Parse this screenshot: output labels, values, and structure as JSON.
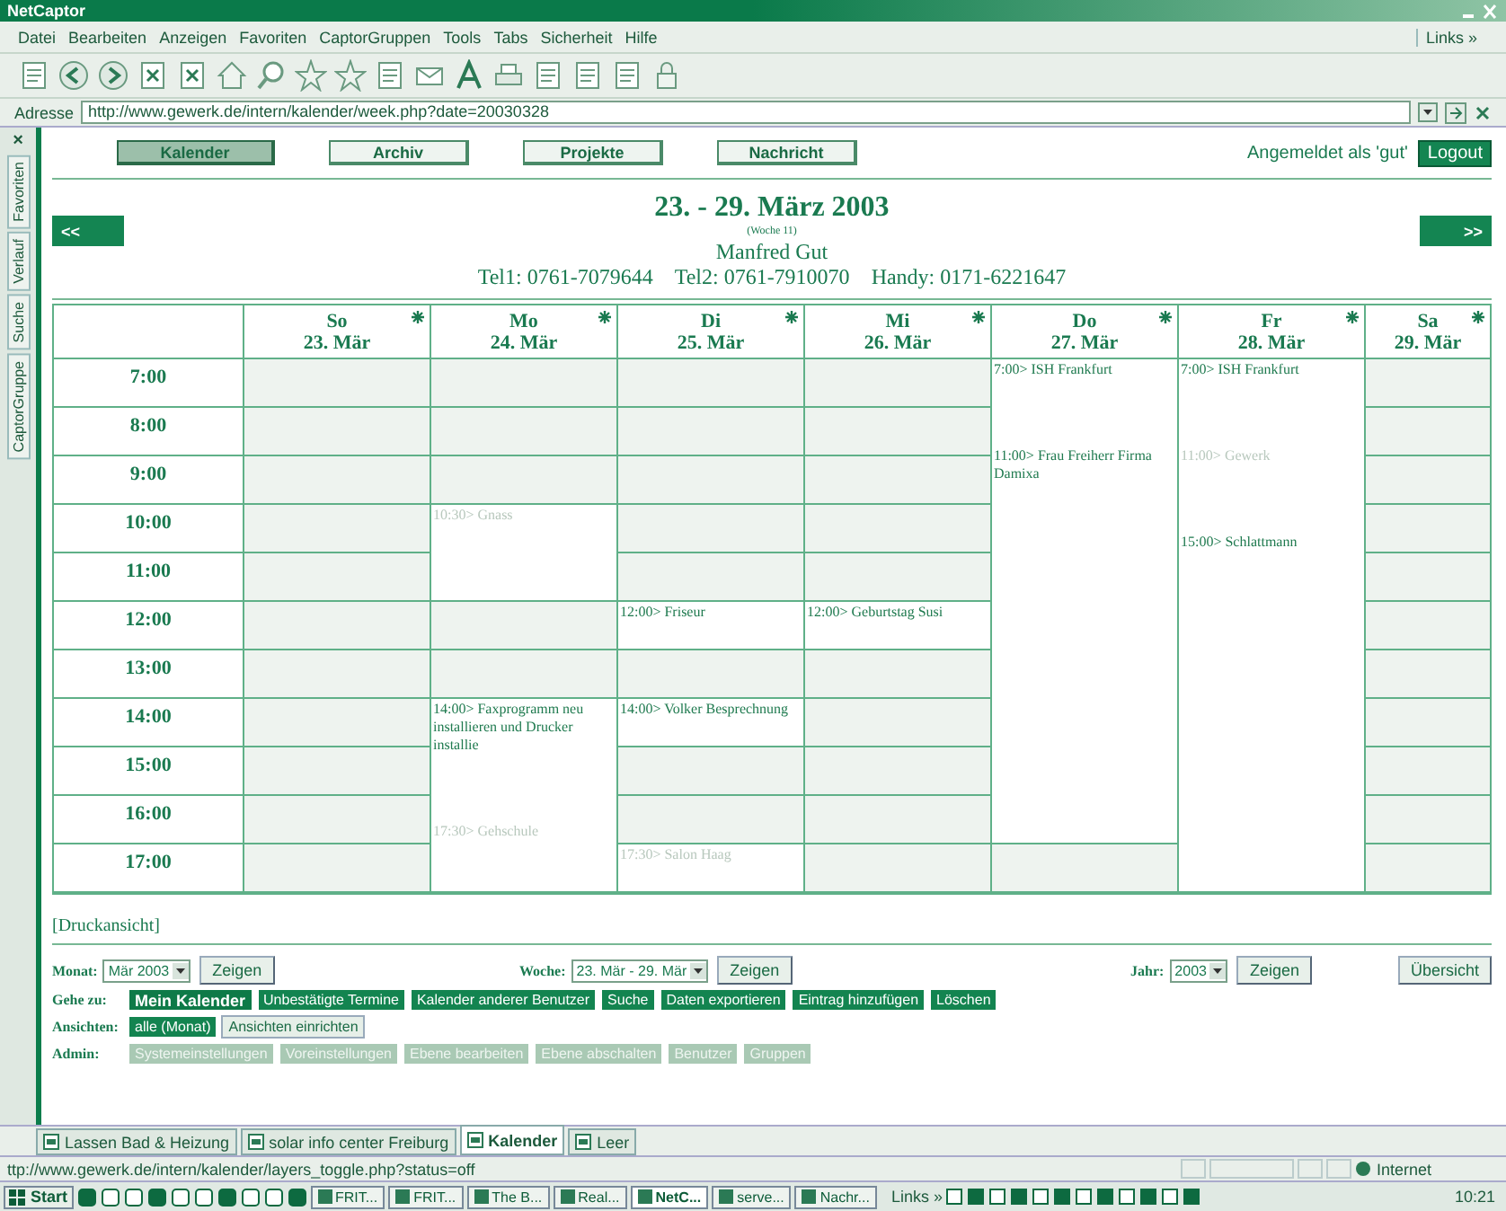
{
  "window": {
    "title": "NetCaptor"
  },
  "menu": [
    "Datei",
    "Bearbeiten",
    "Anzeigen",
    "Favoriten",
    "CaptorGruppen",
    "Tools",
    "Tabs",
    "Sicherheit",
    "Hilfe"
  ],
  "links": {
    "label": "Links",
    "more": "»"
  },
  "address": {
    "label": "Adresse",
    "value": "http://www.gewerk.de/intern/kalender/week.php?date=20030328"
  },
  "side_panel": {
    "close": "×",
    "tabs": [
      "Favoriten",
      "Verlauf",
      "Suche",
      "CaptorGruppe"
    ]
  },
  "nav": [
    {
      "label": "Kalender",
      "selected": true
    },
    {
      "label": "Archiv",
      "selected": false
    },
    {
      "label": "Projekte",
      "selected": false
    },
    {
      "label": "Nachricht",
      "selected": false
    }
  ],
  "login": "Angemeldet als 'gut'",
  "logout": "Logout",
  "prev": "<<",
  "next": ">>",
  "heading": {
    "title": "23. - 29. März 2003",
    "week": "(Woche 11)",
    "name": "Manfred Gut",
    "phones": [
      "Tel1: 0761-7079644",
      "Tel2: 0761-7910070",
      "Handy: 0171-6221647"
    ]
  },
  "hours": [
    "7:00",
    "8:00",
    "9:00",
    "10:00",
    "11:00",
    "12:00",
    "13:00",
    "14:00",
    "15:00",
    "16:00",
    "17:00"
  ],
  "days": [
    {
      "name": "So",
      "date": "23. Mär",
      "slots": [
        {
          "kind": "free"
        },
        {
          "kind": "free"
        },
        {
          "kind": "free"
        },
        {
          "kind": "free"
        },
        {
          "kind": "free"
        },
        {
          "kind": "free"
        },
        {
          "kind": "free"
        },
        {
          "kind": "free"
        },
        {
          "kind": "free"
        },
        {
          "kind": "free"
        },
        {
          "kind": "free"
        }
      ]
    },
    {
      "name": "Mo",
      "date": "24. Mär",
      "slots": [
        {
          "kind": "free"
        },
        {
          "kind": "free"
        },
        {
          "kind": "free"
        },
        {
          "kind": "event",
          "entries": [
            {
              "text": "10:30> Gnass",
              "dimmed": true
            }
          ]
        },
        {
          "kind": "continued"
        },
        {
          "kind": "free"
        },
        {
          "kind": "free"
        },
        {
          "kind": "event",
          "entries": [
            {
              "text": "14:00> Faxprogramm neu installieren und Drucker installie",
              "dimmed": false
            },
            {
              "text": "17:30> Gehschule",
              "dimmed": true
            }
          ]
        },
        {
          "kind": "continued"
        },
        {
          "kind": "continued"
        },
        {
          "kind": "continued"
        }
      ]
    },
    {
      "name": "Di",
      "date": "25. Mär",
      "slots": [
        {
          "kind": "free"
        },
        {
          "kind": "free"
        },
        {
          "kind": "free"
        },
        {
          "kind": "free"
        },
        {
          "kind": "free"
        },
        {
          "kind": "event",
          "entries": [
            {
              "text": "12:00> Friseur",
              "dimmed": false
            }
          ]
        },
        {
          "kind": "free"
        },
        {
          "kind": "event",
          "entries": [
            {
              "text": "14:00> Volker Besprechnung",
              "dimmed": false
            }
          ]
        },
        {
          "kind": "free"
        },
        {
          "kind": "free"
        },
        {
          "kind": "event",
          "entries": [
            {
              "text": "17:30> Salon Haag",
              "dimmed": true
            }
          ]
        }
      ]
    },
    {
      "name": "Mi",
      "date": "26. Mär",
      "slots": [
        {
          "kind": "free"
        },
        {
          "kind": "free"
        },
        {
          "kind": "free"
        },
        {
          "kind": "free"
        },
        {
          "kind": "free"
        },
        {
          "kind": "event",
          "entries": [
            {
              "text": "12:00> Geburtstag Susi",
              "dimmed": false
            }
          ]
        },
        {
          "kind": "free"
        },
        {
          "kind": "free"
        },
        {
          "kind": "free"
        },
        {
          "kind": "free"
        },
        {
          "kind": "free"
        }
      ]
    },
    {
      "name": "Do",
      "date": "27. Mär",
      "slots": [
        {
          "kind": "event",
          "entries": [
            {
              "text": "7:00> ISH Frankfurt",
              "dimmed": false
            },
            {
              "text": "11:00> Frau Freiherr Firma Damixa",
              "dimmed": false
            }
          ]
        },
        {
          "kind": "continued"
        },
        {
          "kind": "continued"
        },
        {
          "kind": "continued"
        },
        {
          "kind": "continued"
        },
        {
          "kind": "continued"
        },
        {
          "kind": "continued"
        },
        {
          "kind": "continued"
        },
        {
          "kind": "continued"
        },
        {
          "kind": "continued"
        },
        {
          "kind": "free"
        }
      ]
    },
    {
      "name": "Fr",
      "date": "28. Mär",
      "slots": [
        {
          "kind": "event",
          "entries": [
            {
              "text": "7:00> ISH Frankfurt",
              "dimmed": false
            },
            {
              "text": "11:00> Gewerk",
              "dimmed": true
            },
            {
              "text": "15:00> Schlattmann",
              "dimmed": false
            }
          ]
        },
        {
          "kind": "continued"
        },
        {
          "kind": "continued"
        },
        {
          "kind": "continued"
        },
        {
          "kind": "continued"
        },
        {
          "kind": "continued"
        },
        {
          "kind": "continued"
        },
        {
          "kind": "continued"
        },
        {
          "kind": "continued"
        },
        {
          "kind": "continued"
        },
        {
          "kind": "continued"
        }
      ]
    },
    {
      "name": "Sa",
      "date": "29. Mär",
      "slots": [
        {
          "kind": "free"
        },
        {
          "kind": "free"
        },
        {
          "kind": "free"
        },
        {
          "kind": "free"
        },
        {
          "kind": "free"
        },
        {
          "kind": "free"
        },
        {
          "kind": "free"
        },
        {
          "kind": "free"
        },
        {
          "kind": "free"
        },
        {
          "kind": "free"
        },
        {
          "kind": "free"
        }
      ]
    }
  ],
  "print_view": "[Druckansicht]",
  "pickers": [
    {
      "label": "Monat:",
      "value": "Mär 2003",
      "button": "Zeigen"
    },
    {
      "label": "Woche:",
      "value": "23. Mär - 29. Mär",
      "button": "Zeigen"
    },
    {
      "label": "Jahr:",
      "value": "2003",
      "button": "Zeigen"
    }
  ],
  "overview": "Übersicht",
  "action_rows": [
    {
      "label": "Gehe zu:",
      "buttons": [
        {
          "label": "Mein Kalender",
          "kind": "current"
        },
        {
          "label": "Unbestätigte Termine",
          "kind": "action"
        },
        {
          "label": "Kalender anderer Benutzer",
          "kind": "action"
        },
        {
          "label": "Suche",
          "kind": "action"
        },
        {
          "label": "Daten exportieren",
          "kind": "action"
        },
        {
          "label": "Eintrag hinzufügen",
          "kind": "action"
        },
        {
          "label": "Löschen",
          "kind": "action"
        }
      ]
    },
    {
      "label": "Ansichten:",
      "buttons": [
        {
          "label": "alle (Monat)",
          "kind": "action"
        },
        {
          "label": "Ansichten einrichten",
          "kind": "option"
        }
      ]
    },
    {
      "label": "Admin:",
      "buttons": [
        {
          "label": "Systemeinstellungen",
          "kind": "disabled"
        },
        {
          "label": "Voreinstellungen",
          "kind": "disabled"
        },
        {
          "label": "Ebene bearbeiten",
          "kind": "disabled"
        },
        {
          "label": "Ebene abschalten",
          "kind": "disabled"
        },
        {
          "label": "Benutzer",
          "kind": "disabled"
        },
        {
          "label": "Gruppen",
          "kind": "disabled"
        }
      ]
    }
  ],
  "page_tabs": [
    {
      "label": "Lassen Bad & Heizung",
      "selected": false
    },
    {
      "label": "solar info center Freiburg",
      "selected": false
    },
    {
      "label": "Kalender",
      "selected": true
    },
    {
      "label": "Leer",
      "selected": false
    }
  ],
  "status_bar": {
    "url": "ttp://www.gewerk.de/intern/kalender/layers_toggle.php?status=off",
    "zone": "Internet"
  },
  "taskbar": {
    "start": "Start",
    "tasks": [
      {
        "label": "FRIT...",
        "selected": false
      },
      {
        "label": "FRIT...",
        "selected": false
      },
      {
        "label": "The B...",
        "selected": false
      },
      {
        "label": "Real...",
        "selected": false
      },
      {
        "label": "NetC...",
        "selected": true
      },
      {
        "label": "serve...",
        "selected": false
      },
      {
        "label": "Nachr...",
        "selected": false
      }
    ],
    "links": "Links",
    "more": "»",
    "clock": "10:21"
  }
}
